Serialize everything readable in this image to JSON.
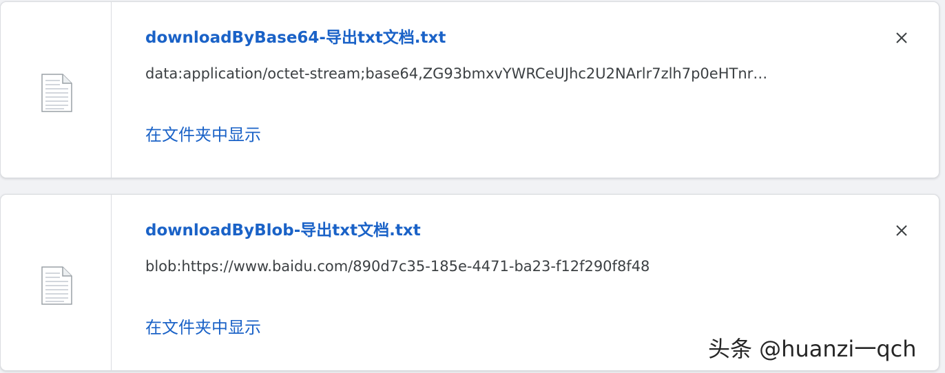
{
  "downloads": [
    {
      "file_name": "downloadByBase64-导出txt文档.txt",
      "url": "data:application/octet-stream;base64,ZG93bmxvYWRCeUJhc2U2NArlr7zlh7p0eHTnr…",
      "action_label": "在文件夹中显示",
      "file_icon": "text-file-icon",
      "close_icon": "close-icon"
    },
    {
      "file_name": "downloadByBlob-导出txt文档.txt",
      "url": "blob:https://www.baidu.com/890d7c35-185e-4471-ba23-f12f290f8f48",
      "action_label": "在文件夹中显示",
      "file_icon": "text-file-icon",
      "close_icon": "close-icon"
    }
  ],
  "watermark": "头条 @huanzi一qch",
  "colors": {
    "link": "#1a62c7",
    "url_text": "#3c4043",
    "page_background": "#f1f2f5",
    "card_border": "#dadce0"
  }
}
